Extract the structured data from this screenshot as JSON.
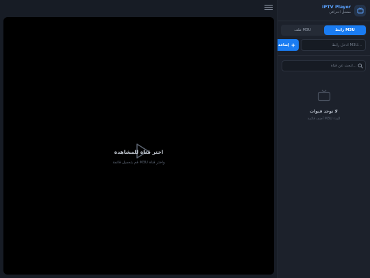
{
  "player": {
    "title": "اختر قناة للمشاهدة",
    "subtitle": "قم بتحميل قائمة M3U واختر قناة"
  },
  "sidebar": {
    "app_title": "IPTV Player",
    "app_subtitle": "مشغل احترافي",
    "tabs": [
      {
        "label": "رابط M3U",
        "active": true
      },
      {
        "label": "ملف M3U",
        "active": false
      }
    ],
    "url_placeholder": "أدخل رابط M3U...",
    "add_label": "إضافة",
    "search_placeholder": "ابحث عن قناة...",
    "empty_title": "لا توجد قنوات",
    "empty_subtitle": "أضف قائمة M3U للبدء"
  },
  "colors": {
    "accent": "#1a7cf2",
    "background": "#171c25",
    "sidebar": "#1c212b",
    "player": "#000000"
  },
  "icons": [
    "menu-icon",
    "play-icon",
    "logo-tv-icon",
    "plus-icon",
    "search-icon",
    "tv-icon"
  ]
}
